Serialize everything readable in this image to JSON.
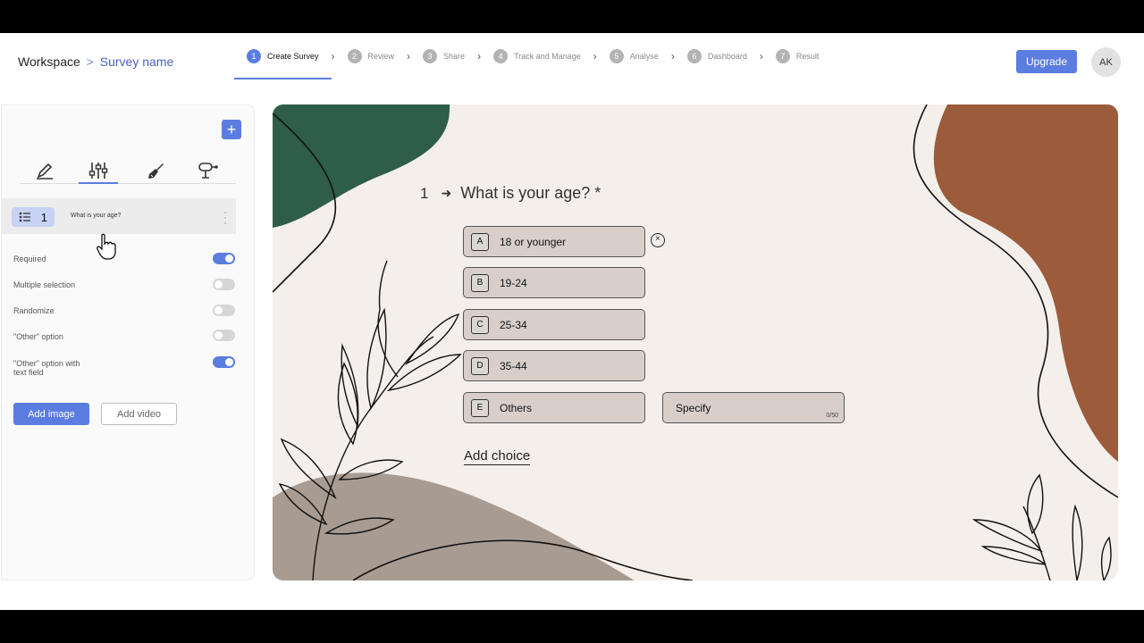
{
  "breadcrumb": {
    "root": "Workspace",
    "separator": ">",
    "current": "Survey name"
  },
  "steps": [
    {
      "num": "1",
      "label": "Create Survey"
    },
    {
      "num": "2",
      "label": "Review"
    },
    {
      "num": "3",
      "label": "Share"
    },
    {
      "num": "4",
      "label": "Track and Manage"
    },
    {
      "num": "5",
      "label": "Analyse"
    },
    {
      "num": "6",
      "label": "Dashboard"
    },
    {
      "num": "7",
      "label": "Result"
    }
  ],
  "header": {
    "upgrade_label": "Upgrade",
    "avatar_initials": "AK"
  },
  "sidebar": {
    "add_label": "+",
    "tools": [
      "pencil-icon",
      "sliders-icon",
      "brush-icon",
      "logic-icon"
    ],
    "question_item": {
      "number": "1",
      "label": "What is your age?"
    },
    "settings": [
      {
        "label": "Required",
        "on": true
      },
      {
        "label": "Multiple selection",
        "on": false
      },
      {
        "label": "Randomize",
        "on": false
      },
      {
        "label": "\"Other\" option",
        "on": false
      },
      {
        "label": "\"Other\" option with text field",
        "on": true
      }
    ],
    "add_image_label": "Add image",
    "add_video_label": "Add video"
  },
  "question": {
    "number": "1",
    "arrow": "➜",
    "title": "What is your age? *",
    "choices": [
      {
        "key": "A",
        "label": "18 or younger"
      },
      {
        "key": "B",
        "label": "19-24"
      },
      {
        "key": "C",
        "label": "25-34"
      },
      {
        "key": "D",
        "label": "35-44"
      },
      {
        "key": "E",
        "label": "Others"
      }
    ],
    "remove_symbol": "×",
    "specify_placeholder": "Specify",
    "specify_count": "0/50",
    "add_choice_label": "Add choice"
  },
  "colors": {
    "accent": "#5c7de0",
    "canvas_bg": "#f5efeb",
    "green_blob": "#2e5d4a",
    "brown_blob": "#9c5b3a",
    "taupe_blob": "#a89b92",
    "choice_bg": "#d8cfcb"
  }
}
